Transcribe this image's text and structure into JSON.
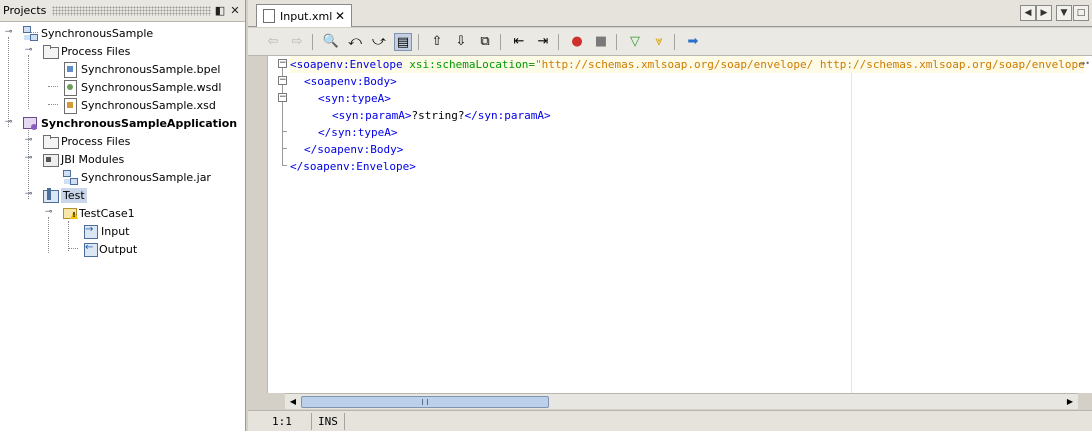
{
  "projects_panel": {
    "title": "Projects",
    "minimize_glyph": "◧",
    "close_glyph": "✕"
  },
  "tree": [
    {
      "label": "SynchronousSample",
      "icon": "project-icon",
      "bold": false
    },
    {
      "label": "Process Files",
      "icon": "folder-icon",
      "bold": false
    },
    {
      "label": "SynchronousSample.bpel",
      "icon": "bpel-file-icon",
      "bold": false
    },
    {
      "label": "SynchronousSample.wsdl",
      "icon": "wsdl-file-icon",
      "bold": false
    },
    {
      "label": "SynchronousSample.xsd",
      "icon": "xsd-file-icon",
      "bold": false
    },
    {
      "label": "SynchronousSampleApplication",
      "icon": "composite-app-icon",
      "bold": true
    },
    {
      "label": "Process Files",
      "icon": "folder-icon",
      "bold": false
    },
    {
      "label": "JBI Modules",
      "icon": "jbi-modules-icon",
      "bold": false
    },
    {
      "label": "SynchronousSample.jar",
      "icon": "project-icon",
      "bold": false
    },
    {
      "label": "Test",
      "icon": "test-folder-icon",
      "bold": false,
      "selected": true
    },
    {
      "label": "TestCase1",
      "icon": "testcase-warning-icon",
      "bold": false
    },
    {
      "label": "Input",
      "icon": "input-icon",
      "bold": false
    },
    {
      "label": "Output",
      "icon": "output-warning-icon",
      "bold": false
    }
  ],
  "editor": {
    "tab_label": "Input.xml",
    "tab_close": "✕",
    "nav": {
      "left": "◀",
      "right": "▶",
      "down": "▼",
      "maximize": "□"
    }
  },
  "toolbar": [
    {
      "name": "back-icon",
      "glyph": "⇦",
      "dim": true
    },
    {
      "name": "forward-icon",
      "glyph": "⇨",
      "dim": true
    },
    {
      "name": "find-icon",
      "glyph": "🔍"
    },
    {
      "name": "find-previous-icon",
      "glyph": "⤺"
    },
    {
      "name": "find-next-icon",
      "glyph": "⤻"
    },
    {
      "name": "toggle-highlight-icon",
      "glyph": "▤",
      "active": true
    },
    {
      "name": "previous-bookmark-icon",
      "glyph": "⇧"
    },
    {
      "name": "next-bookmark-icon",
      "glyph": "⇩"
    },
    {
      "name": "toggle-bookmark-icon",
      "glyph": "⧉"
    },
    {
      "name": "shift-left-icon",
      "glyph": "⇤"
    },
    {
      "name": "shift-right-icon",
      "glyph": "⇥"
    },
    {
      "name": "start-macro-icon",
      "glyph": "●",
      "color": "#d0302b"
    },
    {
      "name": "stop-macro-icon",
      "glyph": "■",
      "color": "#7a7a7a"
    },
    {
      "name": "check-xml-icon",
      "glyph": "▽",
      "color": "#2e9b2e"
    },
    {
      "name": "validate-xml-icon",
      "glyph": "⩔",
      "color": "#d9a400"
    },
    {
      "name": "run-xslt-icon",
      "glyph": "➡",
      "color": "#2a6fc9"
    }
  ],
  "code": {
    "line1": {
      "open": "<soapenv:Envelope ",
      "attr": "xsi:schemaLocation=",
      "value": "\"http://schemas.xmlsoap.org/soap/envelope/ http://schemas.xmlsoap.org/soap/envelope/\""
    },
    "line2": "<soapenv:Body>",
    "line3": "<syn:typeA>",
    "line4": {
      "open": "<syn:paramA>",
      "text": "?string?",
      "close": "</syn:paramA>"
    },
    "line5": "</syn:typeA>",
    "line6": "</soapenv:Body>",
    "line7": "</soapenv:Envelope>"
  },
  "status": {
    "position": "1:1",
    "mode": "INS"
  }
}
